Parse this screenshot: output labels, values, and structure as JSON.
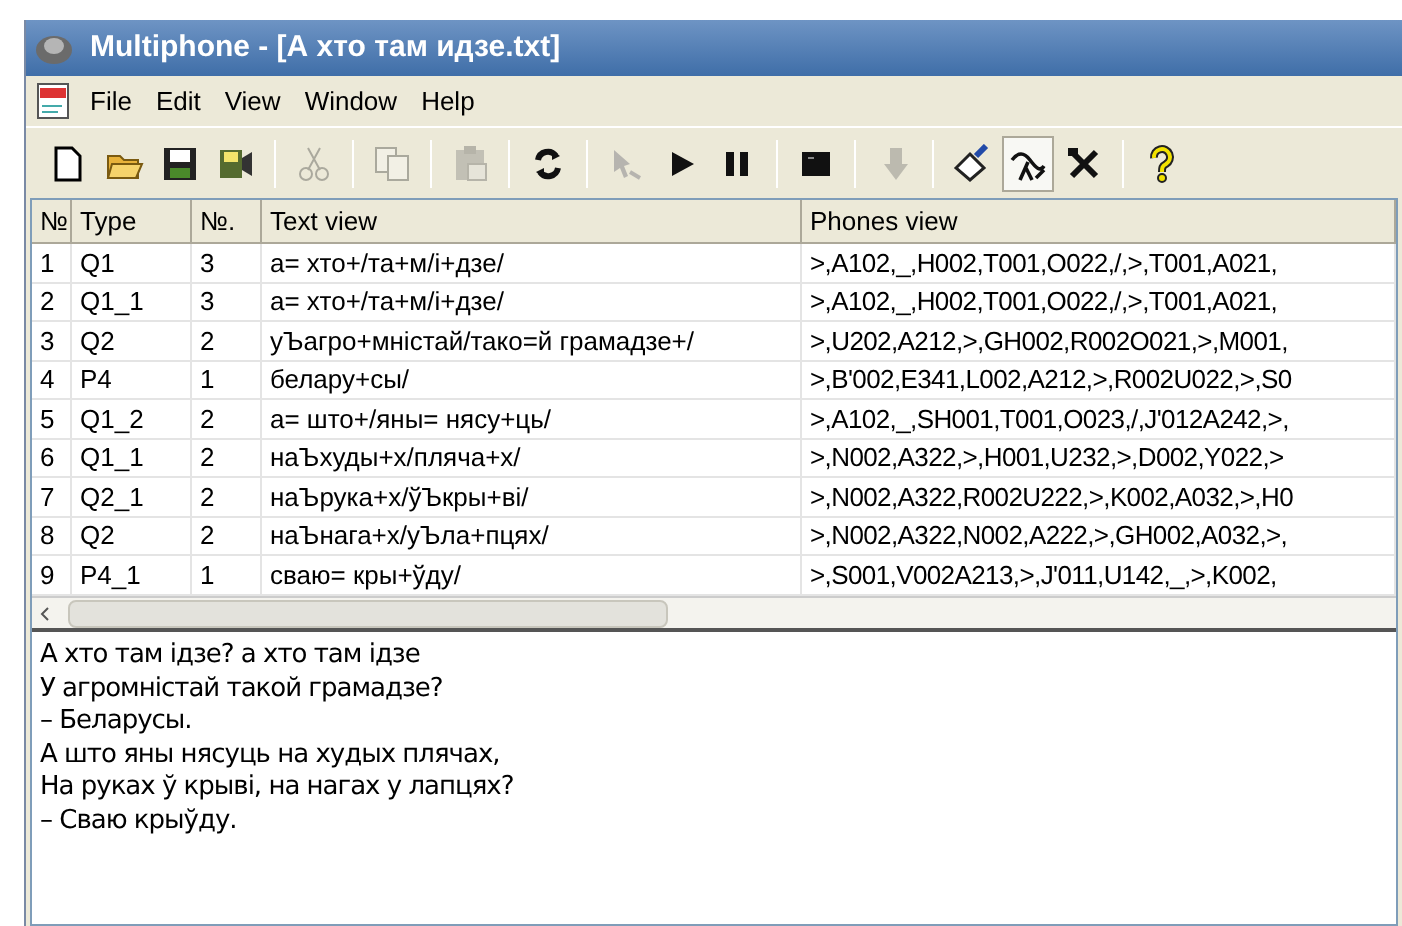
{
  "window": {
    "title": "Multiphone - [А хто там идзе.txt]"
  },
  "menu": [
    "File",
    "Edit",
    "View",
    "Window",
    "Help"
  ],
  "toolbar": [
    {
      "kind": "button",
      "disabled": false,
      "pressed": false
    },
    {
      "kind": "button",
      "disabled": false,
      "pressed": false
    },
    {
      "kind": "button",
      "disabled": false,
      "pressed": false
    },
    {
      "kind": "button",
      "disabled": false,
      "pressed": false
    },
    {
      "kind": "separator"
    },
    {
      "kind": "button",
      "disabled": true,
      "pressed": false
    },
    {
      "kind": "separator"
    },
    {
      "kind": "button",
      "disabled": true,
      "pressed": false
    },
    {
      "kind": "separator"
    },
    {
      "kind": "button",
      "disabled": true,
      "pressed": false
    },
    {
      "kind": "separator"
    },
    {
      "kind": "button",
      "disabled": false,
      "pressed": false
    },
    {
      "kind": "separator"
    },
    {
      "kind": "button",
      "disabled": true,
      "pressed": false
    },
    {
      "kind": "button",
      "disabled": false,
      "pressed": false
    },
    {
      "kind": "button",
      "disabled": false,
      "pressed": false
    },
    {
      "kind": "separator"
    },
    {
      "kind": "button",
      "disabled": false,
      "pressed": false
    },
    {
      "kind": "separator"
    },
    {
      "kind": "button",
      "disabled": true,
      "pressed": false
    },
    {
      "kind": "separator"
    },
    {
      "kind": "button",
      "disabled": false,
      "pressed": false
    },
    {
      "kind": "button",
      "disabled": false,
      "pressed": true
    },
    {
      "kind": "button",
      "disabled": false,
      "pressed": false
    },
    {
      "kind": "separator"
    },
    {
      "kind": "button",
      "disabled": false,
      "pressed": false
    }
  ],
  "table": {
    "columns": [
      "№",
      "Type",
      "№.",
      "Text view",
      "Phones view"
    ],
    "rows": [
      [
        "1",
        "Q1",
        "3",
        "а= хто+/та+м/і+дзе/",
        ">,A102,_,H002,T001,O022,/,>,T001,A021,"
      ],
      [
        "2",
        "Q1_1",
        "3",
        "а= хто+/та+м/і+дзе/",
        ">,A102,_,H002,T001,O022,/,>,T001,A021,"
      ],
      [
        "3",
        "Q2",
        "2",
        "уЪагро+мністай/тако=й грамадзе+/",
        ">,U202,A212,>,GH002,R002O021,>,M001,"
      ],
      [
        "4",
        "P4",
        "1",
        "белару+сы/",
        ">,B'002,E341,L002,A212,>,R002U022,>,S0"
      ],
      [
        "5",
        "Q1_2",
        "2",
        "а= што+/яны= нясу+ць/",
        ">,A102,_,SH001,T001,O023,/,J'012A242,>,"
      ],
      [
        "6",
        "Q1_1",
        "2",
        "наЪхуды+х/пляча+х/",
        ">,N002,A322,>,H001,U232,>,D002,Y022,>"
      ],
      [
        "7",
        "Q2_1",
        "2",
        "наЪрука+х/ўЪкры+ві/",
        ">,N002,A322,R002U222,>,K002,A032,>,H0"
      ],
      [
        "8",
        "Q2",
        "2",
        "наЪнага+х/уЪла+пцях/",
        ">,N002,A322,N002,A222,>,GH002,A032,>,"
      ],
      [
        "9",
        "P4_1",
        "1",
        "сваю= кры+ўду/",
        ">,S001,V002A213,>,J'011,U142,_,>,K002,"
      ]
    ]
  },
  "text": [
    "А хто там ідзе? а хто там ідзе",
    "У агромністай такой грамадзе?",
    "– Беларусы.",
    "А што яны нясуць на худых плячах,",
    "На руках ў крыві, на нагах у лапцях?",
    "– Сваю крыўду."
  ]
}
